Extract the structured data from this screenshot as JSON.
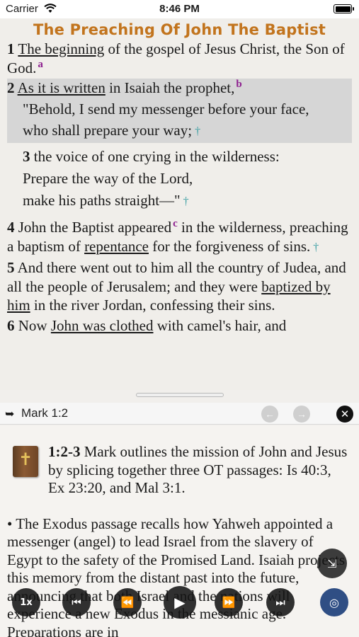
{
  "status": {
    "carrier": "Carrier",
    "time": "8:46 PM"
  },
  "reader": {
    "title": "The Preaching Of John The Baptist",
    "v1": {
      "num": "1",
      "link": "The beginning",
      "text": " of the gospel of Jesus Christ, the Son of God.",
      "note": "a"
    },
    "v2": {
      "num": "2",
      "link": "As it is written",
      "text": " in Isaiah the prophet,",
      "note": "b",
      "line1": "\"Behold, I send my messenger before your face,",
      "line2": "who shall prepare your way;",
      "cross": "†"
    },
    "v3": {
      "num": "3",
      "text": " the voice of one crying in the wilderness:",
      "line1": "Prepare the way of the Lord,",
      "line2": "make his paths straight—\"",
      "cross": "†"
    },
    "v4": {
      "num": "4",
      "text1": " John the Baptist appeared",
      "note": "c",
      "text2": " in the wilderness, preaching a baptism of ",
      "link": "repentance",
      "text3": " for the forgiveness of sins.",
      "cross": "†"
    },
    "v5": {
      "num": "5",
      "text1": " And there went out to him all the country of Judea, and all the people of Jerusalem; and they were ",
      "link": "baptized by him",
      "text2": " in the river Jordan, confessing their sins."
    },
    "v6": {
      "num": "6",
      "text1": " Now ",
      "link": "John was clothed",
      "text2": " with camel's hair, and"
    }
  },
  "notes_header": {
    "reference": "Mark 1:2",
    "back_icon": "arrow-left-icon",
    "forward_icon": "arrow-right-icon",
    "close_icon": "close-icon"
  },
  "notes": {
    "intro_ref": "1:2-3",
    "intro_text": " Mark outlines the mission of John and Jesus by splicing together three OT passages: Is 40:3, Ex 23:20, and Mal 3:1.",
    "para2": "• The Exodus passage recalls how Yahweh appointed a messenger (angel) to lead Israel from the slavery of Egypt to the safety of the Promised Land. Isaiah projects this memory from the distant past into the future, announcing that both Israel and the nations will experience a new Exodus in the messianic age. Preparations are in"
  },
  "player": {
    "speed": "1x"
  },
  "colors": {
    "title": "#c2741d",
    "note_mark": "#8d1f8f",
    "cross": "#3c9fa3",
    "highlight": "#d6d6d6"
  }
}
